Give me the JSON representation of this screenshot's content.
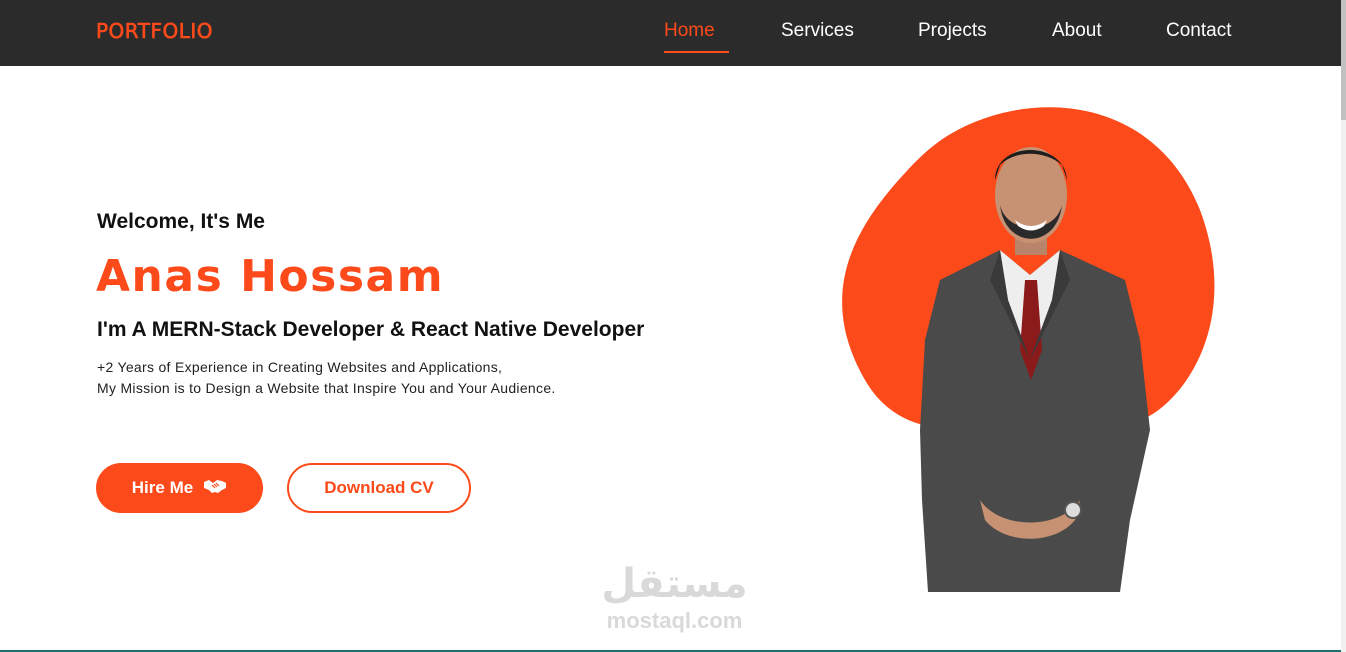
{
  "nav": {
    "logo": "PORTFOLIO",
    "links": [
      {
        "label": "Home",
        "active": true
      },
      {
        "label": "Services",
        "active": false
      },
      {
        "label": "Projects",
        "active": false
      },
      {
        "label": "About",
        "active": false
      },
      {
        "label": "Contact",
        "active": false
      }
    ]
  },
  "hero": {
    "greeting": "Welcome, It's Me",
    "name": "Anas Hossam",
    "role": "I'm A MERN-Stack Developer & React Native Developer",
    "description_line1": "+2 Years of Experience in Creating Websites and Applications,",
    "description_line2": "My Mission is to Design a Website that Inspire You and Your Audience.",
    "hire_button": "Hire Me",
    "hire_icon": "handshake-icon",
    "cv_button": "Download CV"
  },
  "watermark": {
    "arabic": "مستقل",
    "latin": "mostaql.com"
  },
  "colors": {
    "accent": "#fc4a1a",
    "navbar_bg": "#2b2b2b",
    "text": "#111111"
  }
}
